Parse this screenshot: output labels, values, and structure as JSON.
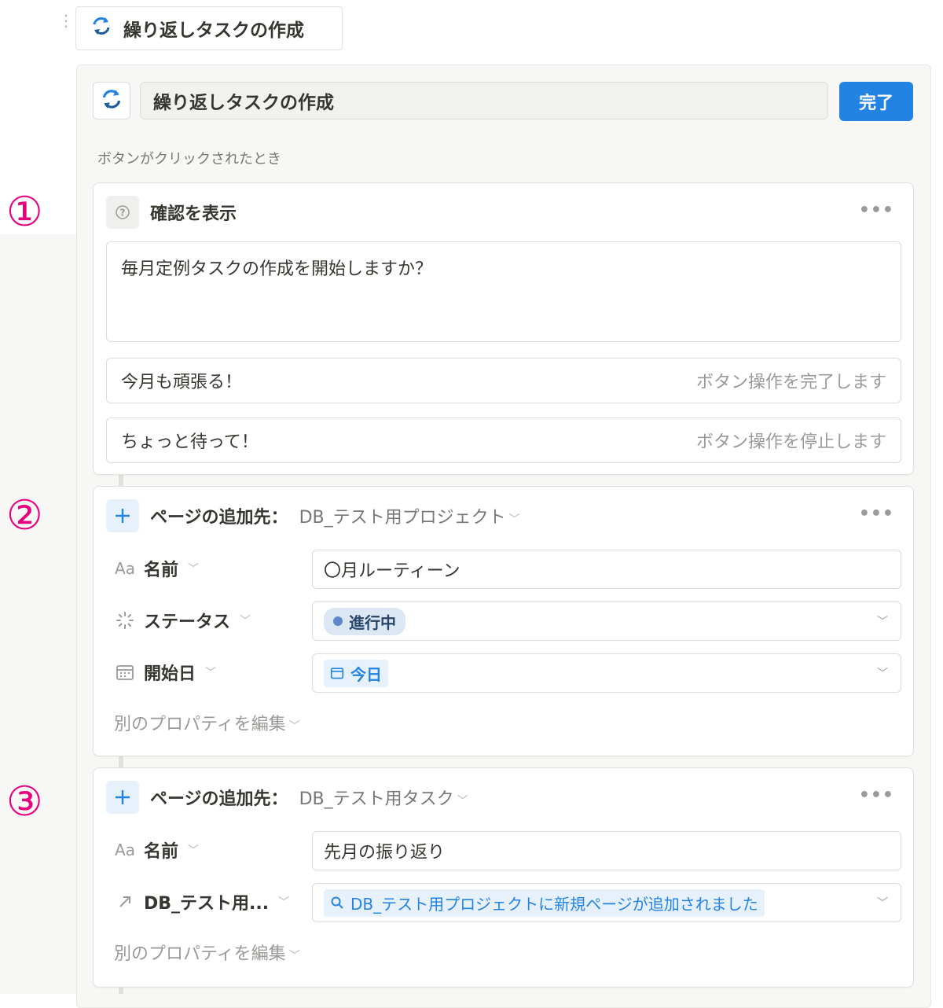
{
  "top_button": {
    "label": "繰り返しタスクの作成"
  },
  "editor": {
    "name_value": "繰り返しタスクの作成",
    "done_label": "完了",
    "trigger_label": "ボタンがクリックされたとき"
  },
  "markers": [
    "①",
    "②",
    "③"
  ],
  "confirm_step": {
    "title": "確認を表示",
    "message": "毎月定例タスクの作成を開始しますか？",
    "options": [
      {
        "label": "今月も頑張る！",
        "hint": "ボタン操作を完了します"
      },
      {
        "label": "ちょっと待って！",
        "hint": "ボタン操作を停止します"
      }
    ]
  },
  "add_page_1": {
    "prefix": "ページの追加先：",
    "db": "DB_テスト用プロジェクト",
    "props": [
      {
        "icon": "Aa",
        "name": "名前",
        "value": "〇月ルーティーン"
      },
      {
        "icon": "spinner",
        "name": "ステータス",
        "value": "進行中"
      },
      {
        "icon": "calendar",
        "name": "開始日",
        "value": "今日"
      }
    ],
    "edit_more": "別のプロパティを編集"
  },
  "add_page_2": {
    "prefix": "ページの追加先：",
    "db": "DB_テスト用タスク",
    "props": [
      {
        "icon": "Aa",
        "name": "名前",
        "value": "先月の振り返り"
      },
      {
        "icon": "arrow",
        "name": "DB_テスト用...",
        "value": "DB_テスト用プロジェクトに新規ページが追加されました"
      }
    ],
    "edit_more": "別のプロパティを編集"
  },
  "colors": {
    "accent": "#2383e2",
    "marker": "#e6007e"
  }
}
